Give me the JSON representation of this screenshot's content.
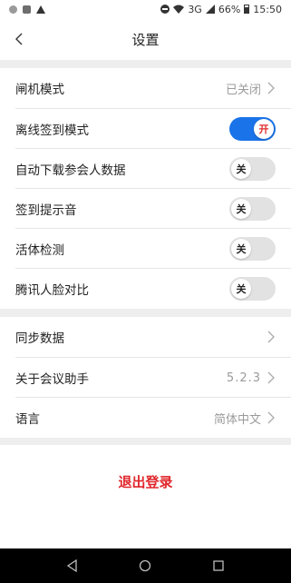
{
  "status_bar": {
    "network": "3G",
    "battery": "66%",
    "time": "15:50"
  },
  "header": {
    "title": "设置"
  },
  "settings": {
    "gate_mode": {
      "label": "闸机模式",
      "value": "已关闭"
    },
    "offline_checkin": {
      "label": "离线签到模式",
      "state": "开"
    },
    "auto_download": {
      "label": "自动下载参会人数据",
      "state": "关"
    },
    "checkin_sound": {
      "label": "签到提示音",
      "state": "关"
    },
    "liveness": {
      "label": "活体检测",
      "state": "关"
    },
    "tencent_face": {
      "label": "腾讯人脸对比",
      "state": "关"
    },
    "sync": {
      "label": "同步数据"
    },
    "about": {
      "label": "关于会议助手",
      "value": "5.2.3"
    },
    "language": {
      "label": "语言",
      "value": "简体中文"
    }
  },
  "logout": {
    "label": "退出登录"
  },
  "colors": {
    "accent": "#1a73e8",
    "danger": "#e0262b",
    "section_gap": "#eeeeee"
  }
}
